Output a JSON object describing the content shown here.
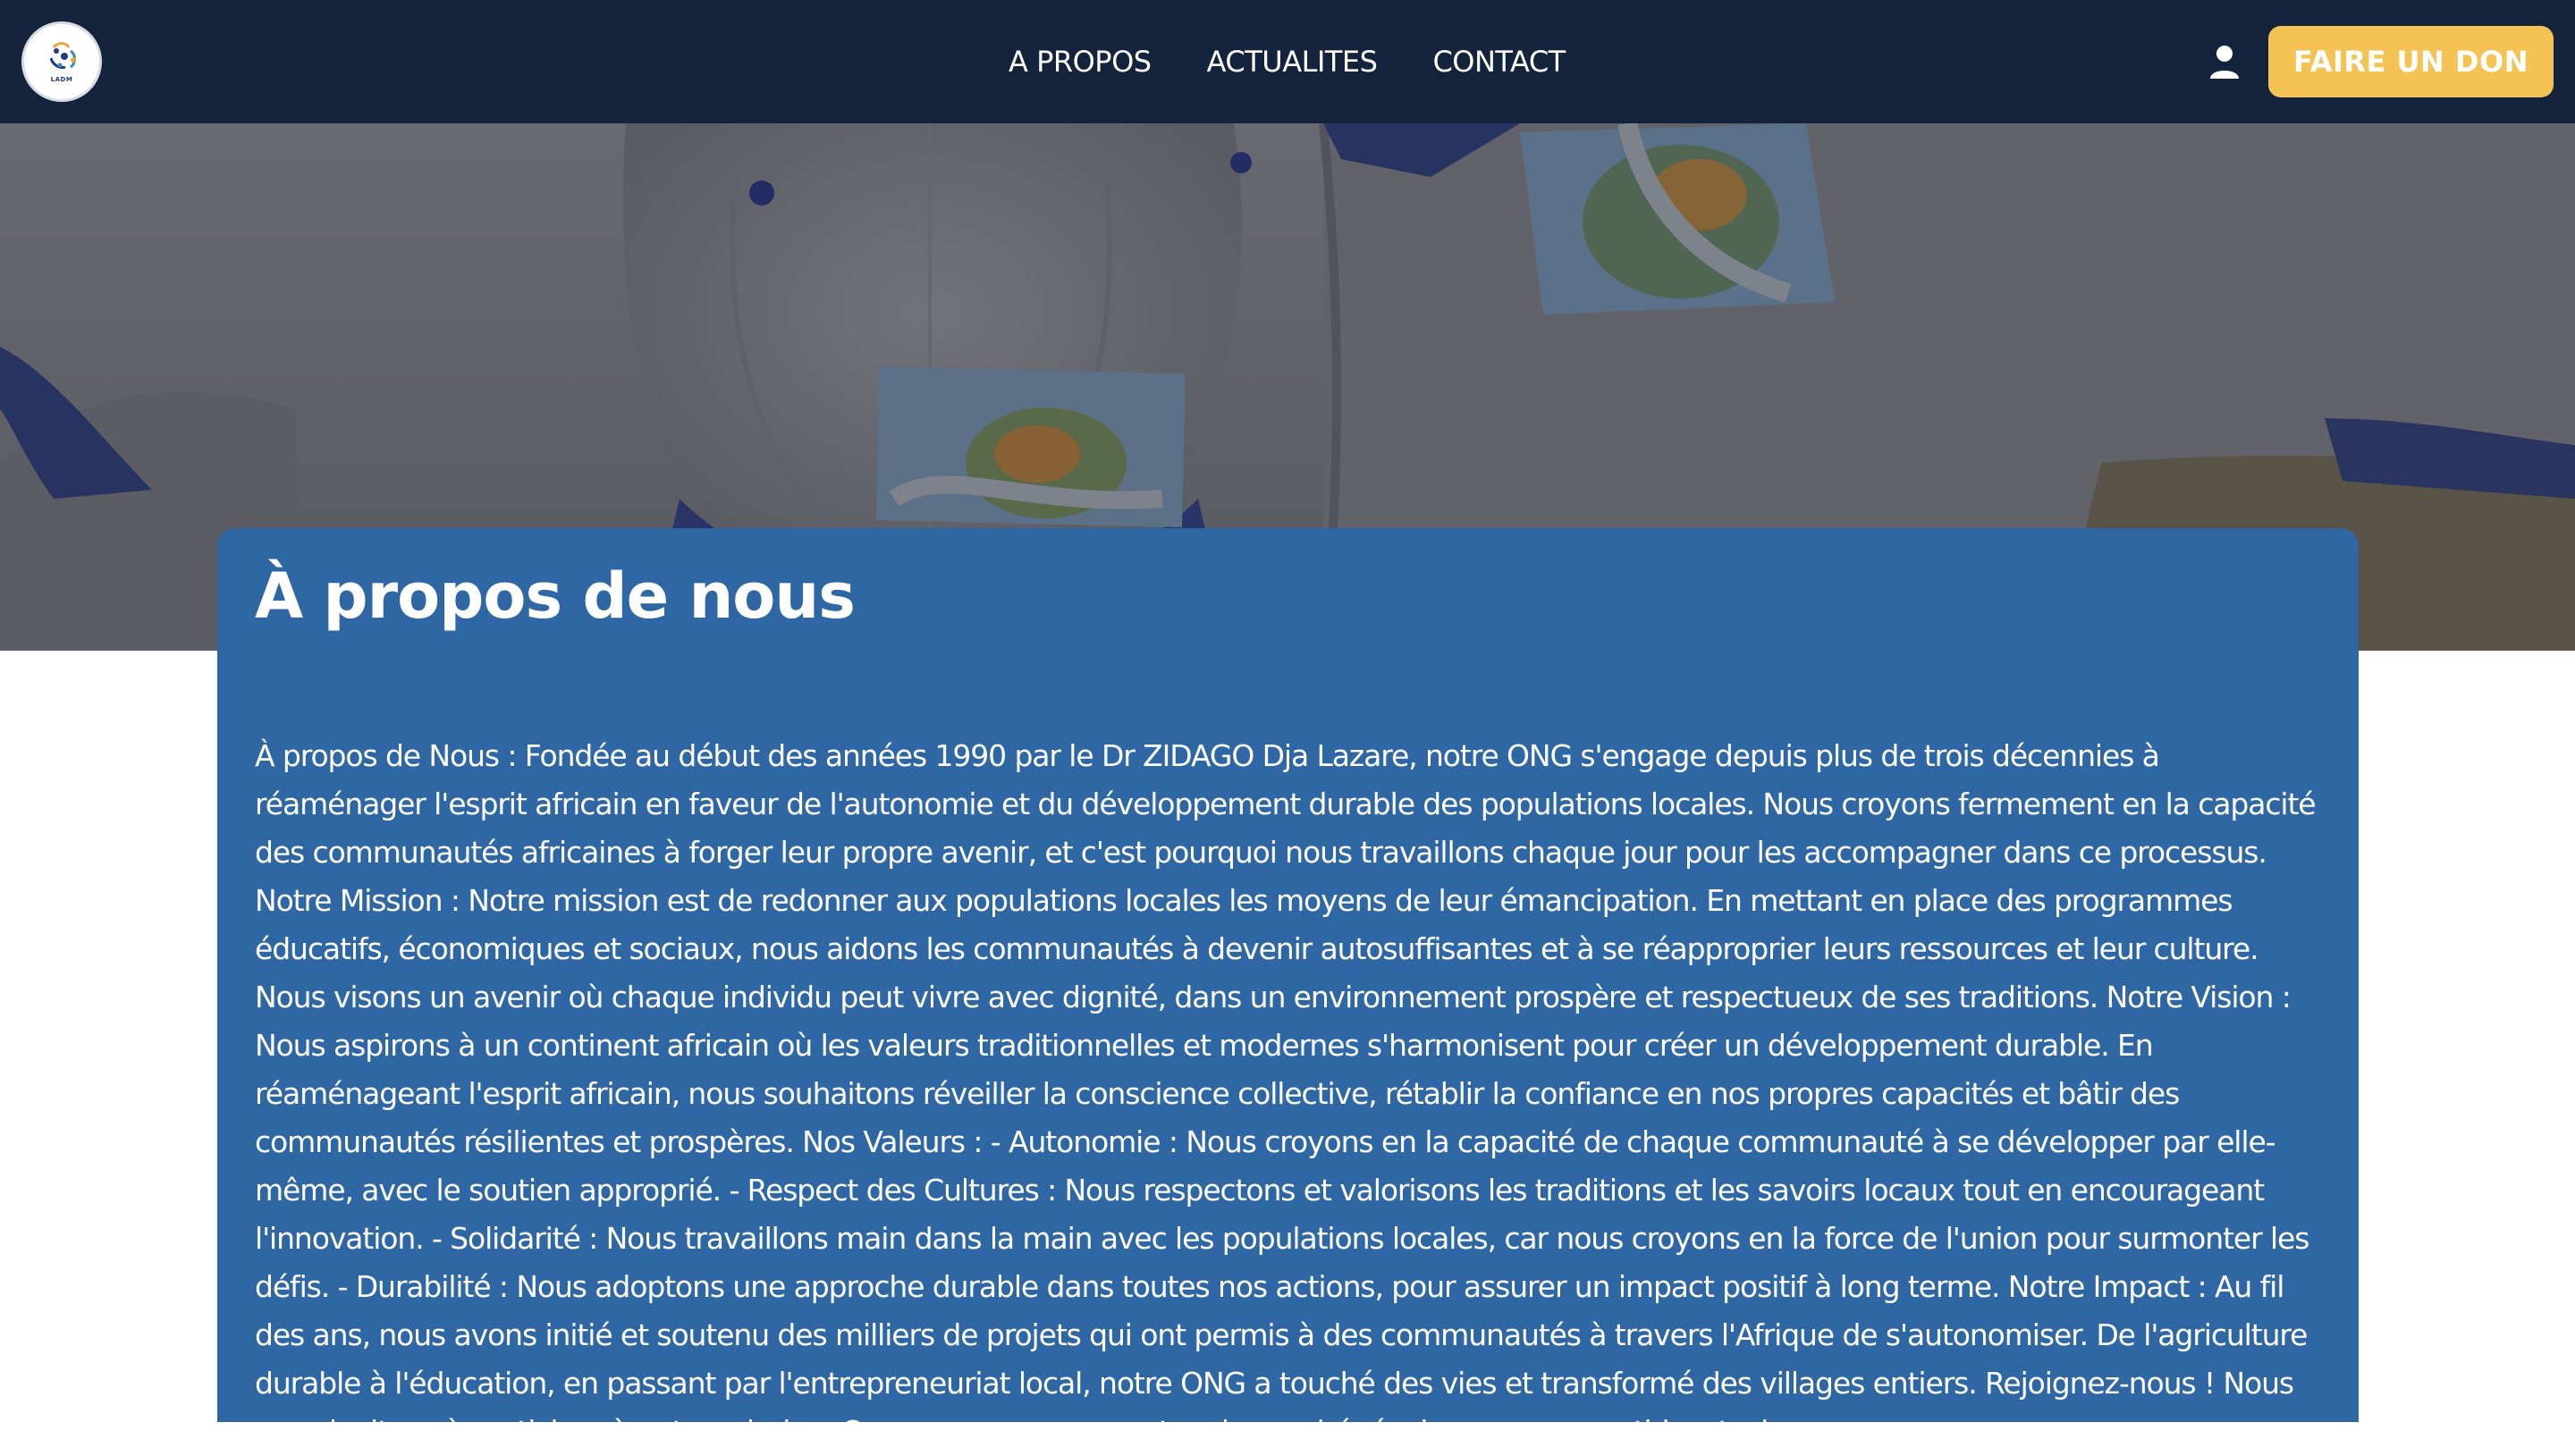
{
  "header": {
    "logo_text": "LADM",
    "nav": [
      {
        "label": "A PROPOS"
      },
      {
        "label": "ACTUALITES"
      },
      {
        "label": "CONTACT"
      }
    ],
    "account_icon": "user-icon",
    "donate_label": "FAIRE UN DON"
  },
  "hero": {
    "image": "photo of white ONG caps and shirts with globe-in-hand emblem"
  },
  "about": {
    "title": "À propos de nous",
    "body": "À propos de Nous : Fondée au début des années 1990 par le Dr ZIDAGO Dja Lazare, notre ONG s'engage depuis plus de trois décennies à réaménager l'esprit africain en faveur de l'autonomie et du développement durable des populations locales. Nous croyons fermement en la capacité des communautés africaines à forger leur propre avenir, et c'est pourquoi nous travaillons chaque jour pour les accompagner dans ce processus. Notre Mission : Notre mission est de redonner aux populations locales les moyens de leur émancipation. En mettant en place des programmes éducatifs, économiques et sociaux, nous aidons les communautés à devenir autosuffisantes et à se réapproprier leurs ressources et leur culture. Nous visons un avenir où chaque individu peut vivre avec dignité, dans un environnement prospère et respectueux de ses traditions. Notre Vision : Nous aspirons à un continent africain où les valeurs traditionnelles et modernes s'harmonisent pour créer un développement durable. En réaménageant l'esprit africain, nous souhaitons réveiller la conscience collective, rétablir la confiance en nos propres capacités et bâtir des communautés résilientes et prospères. Nos Valeurs : - Autonomie : Nous croyons en la capacité de chaque communauté à se développer par elle-même, avec le soutien approprié. - Respect des Cultures : Nous respectons et valorisons les traditions et les savoirs locaux tout en encourageant l'innovation. - Solidarité : Nous travaillons main dans la main avec les populations locales, car nous croyons en la force de l'union pour surmonter les défis. - Durabilité : Nous adoptons une approche durable dans toutes nos actions, pour assurer un impact positif à long terme. Notre Impact : Au fil des ans, nous avons initié et soutenu des milliers de projets qui ont permis à des communautés à travers l'Afrique de s'autonomiser. De l'agriculture durable à l'éducation, en passant par l'entrepreneuriat local, notre ONG a touché des vies et transformé des villages entiers. Rejoignez-nous ! Nous vous invitons à participer à notre mission. Que vous soyez un partenaire, un bénévole ou un sympathisant, chaque"
  },
  "colors": {
    "header_bg": "#13233b",
    "accent": "#f5c354",
    "card_bg": "#2e67a4"
  }
}
